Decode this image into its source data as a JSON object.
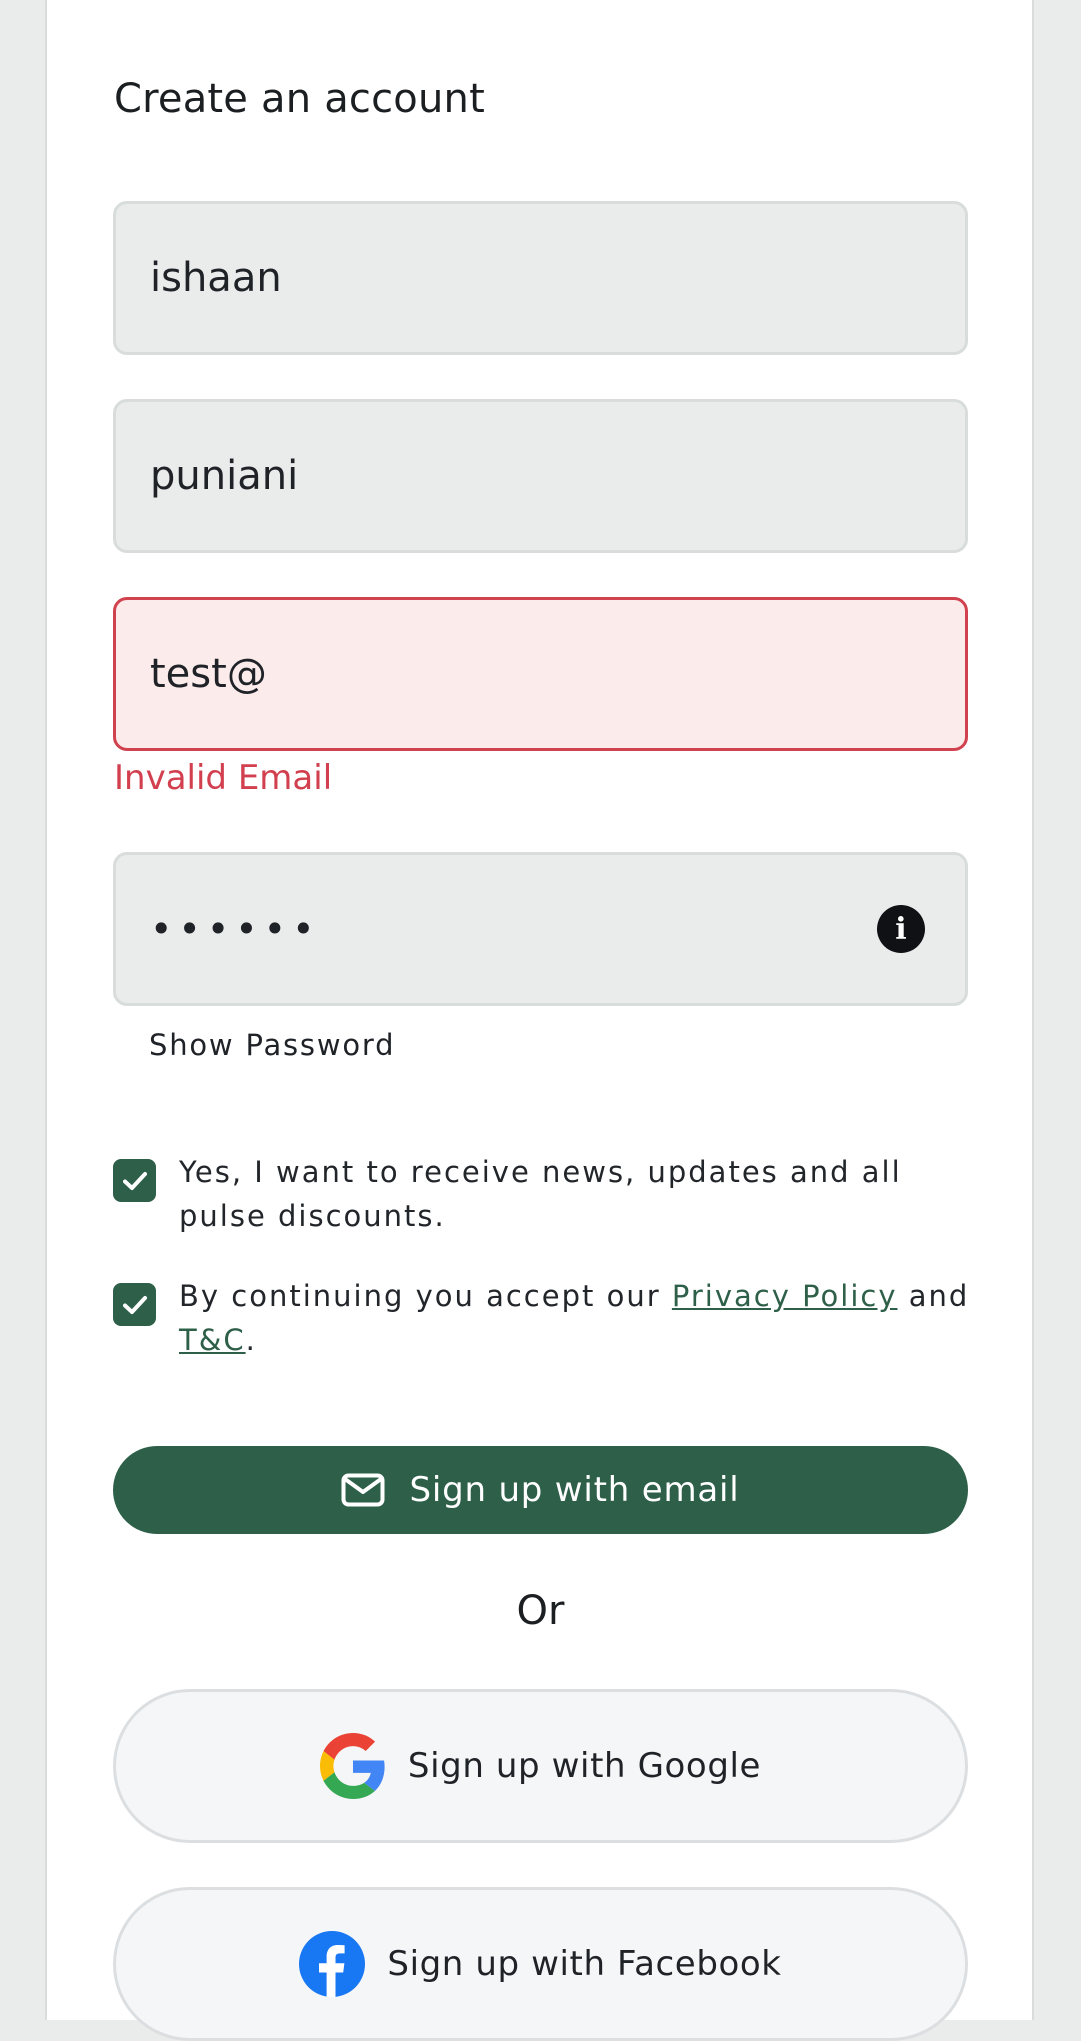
{
  "page": {
    "title": "Create an account"
  },
  "form": {
    "first_name_value": "ishaan",
    "last_name_value": "puniani",
    "email_value": "test@",
    "email_error": "Invalid Email",
    "password_mask": "••••••",
    "show_password_label": "Show Password"
  },
  "consent": {
    "news_text": "Yes, I want to receive news, updates and all pulse discounts.",
    "terms_prefix": "By continuing you accept our ",
    "privacy_link": "Privacy Policy",
    "terms_and": " and ",
    "terms_link": "T&C",
    "terms_suffix": "."
  },
  "actions": {
    "email_signup_label": "Sign up with email",
    "or_label": "Or",
    "google_signup_label": "Sign up with Google",
    "facebook_signup_label": "Sign up with Facebook"
  },
  "colors": {
    "brand_green": "#2e6049",
    "error_red": "#d23f4e",
    "field_bg": "#e9ecea",
    "error_field_bg": "#fcebeb"
  },
  "icons": {
    "info": "info-icon",
    "checkmark": "checkmark-icon",
    "mail": "mail-icon",
    "google": "google-logo-icon",
    "facebook": "facebook-logo-icon"
  }
}
